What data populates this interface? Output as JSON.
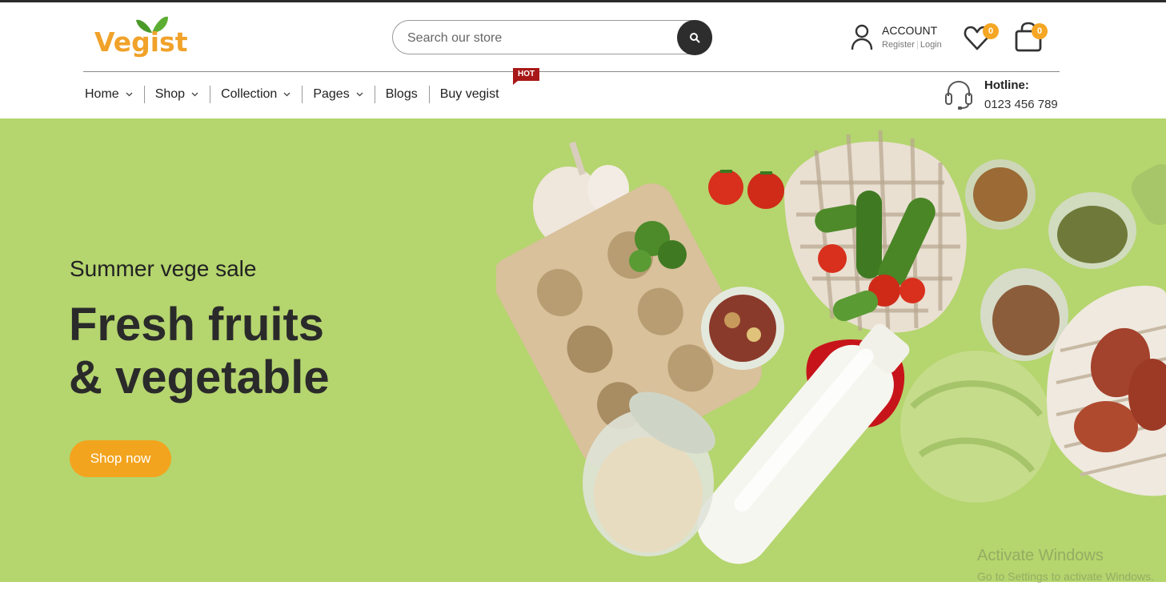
{
  "brand": {
    "name": "Vegist",
    "accent": "#f3a41e"
  },
  "search": {
    "placeholder": "Search our store"
  },
  "account": {
    "title": "ACCOUNT",
    "register": "Register",
    "login": "Login"
  },
  "wishlist": {
    "count": "0"
  },
  "cart": {
    "count": "0"
  },
  "nav": {
    "items": [
      {
        "label": "Home",
        "has_dropdown": true
      },
      {
        "label": "Shop",
        "has_dropdown": true
      },
      {
        "label": "Collection",
        "has_dropdown": true
      },
      {
        "label": "Pages",
        "has_dropdown": true
      },
      {
        "label": "Blogs",
        "has_dropdown": false
      },
      {
        "label": "Buy vegist",
        "has_dropdown": false
      }
    ],
    "hot_badge": "HOT"
  },
  "hotline": {
    "label": "Hotline:",
    "number": "0123 456 789"
  },
  "hero": {
    "subtitle": "Summer vege sale",
    "title_line1": "Fresh fruits",
    "title_line2": "& vegetable",
    "button": "Shop now",
    "background": "#b5d56e"
  },
  "watermark": {
    "line1": "Activate Windows",
    "line2": "Go to Settings to activate Windows."
  }
}
